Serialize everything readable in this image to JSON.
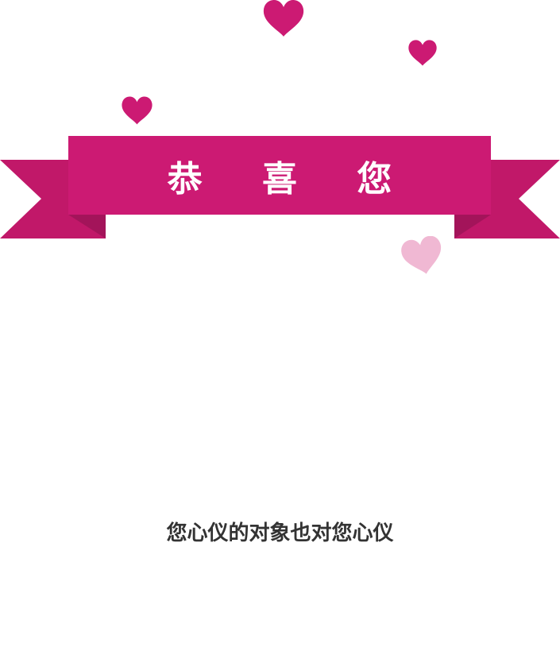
{
  "ribbon": {
    "title": "恭 喜 您"
  },
  "message": "您心仪的对象也对您心仪",
  "colors": {
    "ribbon_main": "#cc1a73",
    "ribbon_tail": "#c11869",
    "ribbon_fold": "#a3145a",
    "heart": "#cc1a73",
    "heart_light": "#f0b8d3",
    "text": "#333333"
  },
  "icons": [
    "heart-icon",
    "ribbon-banner"
  ]
}
